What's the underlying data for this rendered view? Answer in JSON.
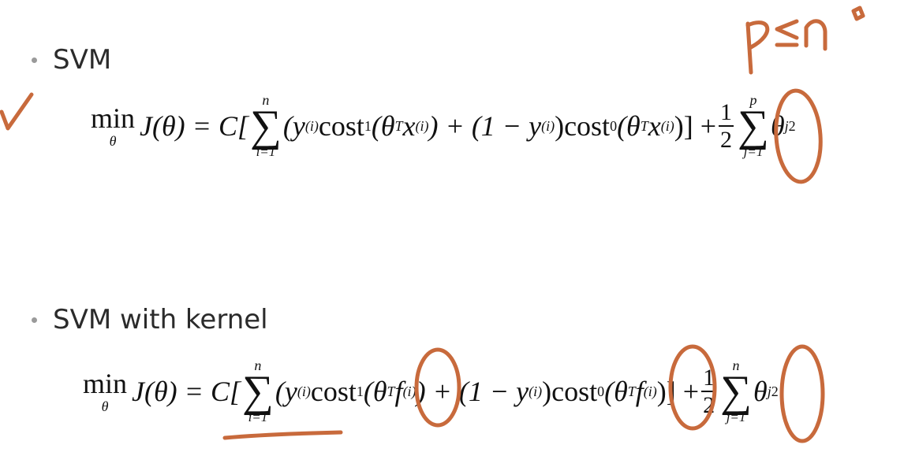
{
  "bullets": [
    {
      "label": "SVM"
    },
    {
      "label": "SVM with kernel"
    }
  ],
  "formula1": {
    "min": "min",
    "min_sub": "θ",
    "lhs": "J(θ) = C[",
    "sum_top": "n",
    "sum_bot": "i=1",
    "t1": "(y",
    "sup_i": "(i)",
    "cost1": "cost",
    "sub1": "1",
    "t2": "(θ",
    "supT": "T",
    "x": "x",
    "t3": ") + (1 − y",
    "t4": ")cost",
    "sub0": "0",
    "t5": ")] +",
    "half_num": "1",
    "half_den": "2",
    "sum2_top": "p",
    "sum2_bot": "j=1",
    "theta": "θ",
    "sub_j": "j",
    "sup2": "2"
  },
  "formula2": {
    "min": "min",
    "min_sub": "θ",
    "lhs": "J(θ) = C[",
    "sum_top": "n",
    "sum_bot": "i=1",
    "t1": "(y",
    "sup_i": "(i)",
    "cost1": "cost",
    "sub1": "1",
    "t2": "(θ",
    "supT": "T",
    "f": "f",
    "t3": ") + (1 − y",
    "t4": ")cost",
    "sub0": "0",
    "t5": ")] +",
    "half_num": "1",
    "half_den": "2",
    "sum2_top": "n",
    "sum2_bot": "j=1",
    "theta": "θ",
    "sub_j": "j",
    "sup2": "2"
  },
  "handwriting": {
    "note": "p ≤ n",
    "color": "#c86a3c"
  }
}
